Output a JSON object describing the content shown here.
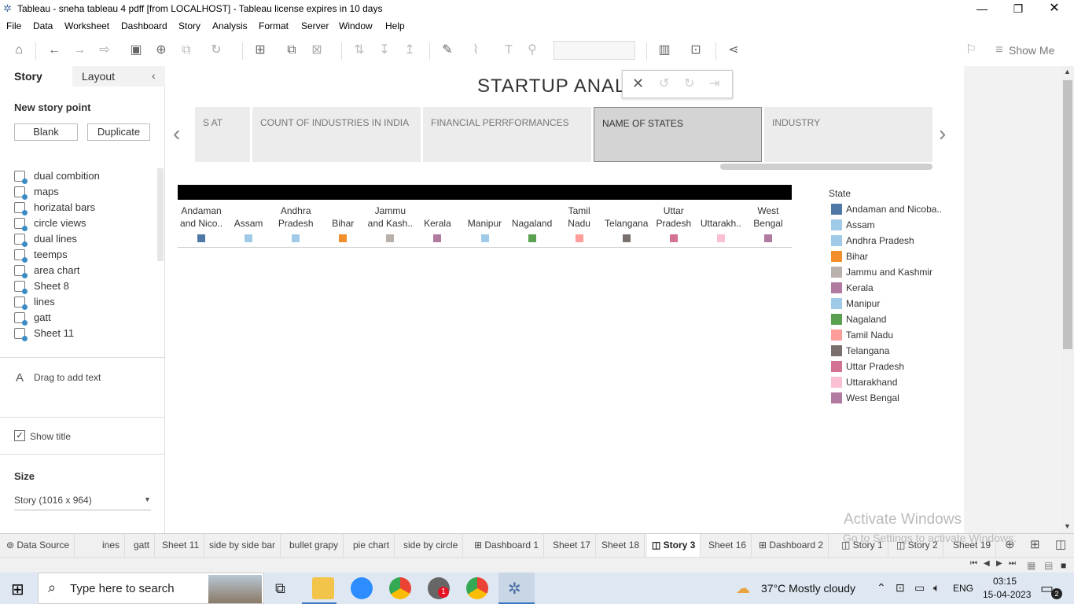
{
  "window": {
    "title": "Tableau - sneha tableau 4 pdff [from LOCALHOST] - Tableau license expires in 10 days"
  },
  "menu": [
    "File",
    "Data",
    "Worksheet",
    "Dashboard",
    "Story",
    "Analysis",
    "Format",
    "Server",
    "Window",
    "Help"
  ],
  "toolbar": {
    "show_me": "Show Me"
  },
  "left_panel": {
    "tab_story": "Story",
    "tab_layout": "Layout",
    "new_story_point": "New story point",
    "blank_button": "Blank",
    "duplicate_button": "Duplicate",
    "sheets": [
      "dual combition",
      "maps",
      "horizatal bars",
      "circle views",
      "dual lines",
      "teemps",
      "area chart",
      "Sheet 8",
      "lines",
      " gatt",
      "Sheet 11"
    ],
    "drag_text": "Drag to add text",
    "show_title": "Show title",
    "size_heading": "Size",
    "size_value": "Story (1016 x 964)"
  },
  "story": {
    "title": "STARTUP ANALY",
    "points": [
      "S AT",
      "COUNT OF INDUSTRIES IN INDIA",
      "FINANCIAL PERRFORMANCES",
      "NAME OF STATES",
      "INDUSTRY"
    ],
    "active_point": "NAME OF STATES"
  },
  "chart_data": {
    "type": "table",
    "columns": [
      {
        "line1": "Andaman",
        "line2": "and Nico..",
        "color": "#4e79a7"
      },
      {
        "line1": "",
        "line2": "Assam",
        "color": "#a0cbe8"
      },
      {
        "line1": "Andhra",
        "line2": "Pradesh",
        "color": "#a0cbe8"
      },
      {
        "line1": "",
        "line2": "Bihar",
        "color": "#f28e2b"
      },
      {
        "line1": "Jammu",
        "line2": "and Kash..",
        "color": "#bab0ac"
      },
      {
        "line1": "",
        "line2": "Kerala",
        "color": "#b07aa1"
      },
      {
        "line1": "",
        "line2": "Manipur",
        "color": "#a0cbe8"
      },
      {
        "line1": "",
        "line2": "Nagaland",
        "color": "#59a14f"
      },
      {
        "line1": "Tamil",
        "line2": "Nadu",
        "color": "#ff9d9a"
      },
      {
        "line1": "",
        "line2": "Telangana",
        "color": "#79706e"
      },
      {
        "line1": "Uttar",
        "line2": "Pradesh",
        "color": "#d37295"
      },
      {
        "line1": "",
        "line2": "Uttarakh..",
        "color": "#fabfd2"
      },
      {
        "line1": "West",
        "line2": "Bengal",
        "color": "#b07aa1"
      }
    ],
    "legend_title": "State",
    "legend": [
      {
        "name": "Andaman and Nicoba..",
        "color": "#4e79a7"
      },
      {
        "name": "Assam",
        "color": "#a0cbe8"
      },
      {
        "name": "Andhra Pradesh",
        "color": "#a0cbe8"
      },
      {
        "name": "Bihar",
        "color": "#f28e2b"
      },
      {
        "name": "Jammu and Kashmir",
        "color": "#bab0ac"
      },
      {
        "name": "Kerala",
        "color": "#b07aa1"
      },
      {
        "name": "Manipur",
        "color": "#a0cbe8"
      },
      {
        "name": "Nagaland",
        "color": "#59a14f"
      },
      {
        "name": "Tamil Nadu",
        "color": "#ff9d9a"
      },
      {
        "name": "Telangana",
        "color": "#79706e"
      },
      {
        "name": "Uttar Pradesh",
        "color": "#d37295"
      },
      {
        "name": "Uttarakhand",
        "color": "#fabfd2"
      },
      {
        "name": "West Bengal",
        "color": "#b07aa1"
      }
    ]
  },
  "watermark": {
    "line1": "Activate Windows",
    "line2": "Go to Settings to activate Windows."
  },
  "sheet_tabs": [
    "Data Source",
    "ines",
    "gatt",
    "Sheet 11",
    "side by side bar",
    "bullet grapy",
    "pie chart",
    "side by circle",
    "Dashboard 1",
    "Sheet 17",
    "Sheet 18",
    "Story 3",
    "Sheet 16",
    "Dashboard 2",
    "Story 1",
    "Story 2",
    "Sheet 19"
  ],
  "active_sheet_tab": "Story 3",
  "taskbar": {
    "search_placeholder": "Type here to search",
    "weather": "37°C  Mostly cloudy",
    "lang": "ENG",
    "time": "03:15",
    "date": "15-04-2023",
    "notif_count": "2",
    "badge": "1"
  }
}
